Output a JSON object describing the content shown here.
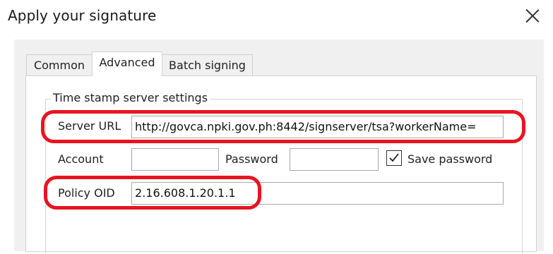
{
  "window": {
    "title": "Apply your signature",
    "close_icon": "close-icon"
  },
  "tabs": [
    {
      "label": "Common",
      "active": false
    },
    {
      "label": "Advanced",
      "active": true
    },
    {
      "label": "Batch signing",
      "active": false
    }
  ],
  "tsa_group": {
    "title": "Time stamp server settings",
    "server_url_label": "Server URL",
    "server_url_value": "http://govca.npki.gov.ph:8442/signserver/tsa?workerName=",
    "account_label": "Account",
    "account_value": "",
    "password_label": "Password",
    "password_value": "",
    "save_password_label": "Save password",
    "save_password_checked": true,
    "policy_oid_label": "Policy OID",
    "policy_oid_value": "2.16.608.1.20.1.1"
  },
  "colors": {
    "highlight": "#e8141f",
    "panel": "#f0f0f0"
  }
}
